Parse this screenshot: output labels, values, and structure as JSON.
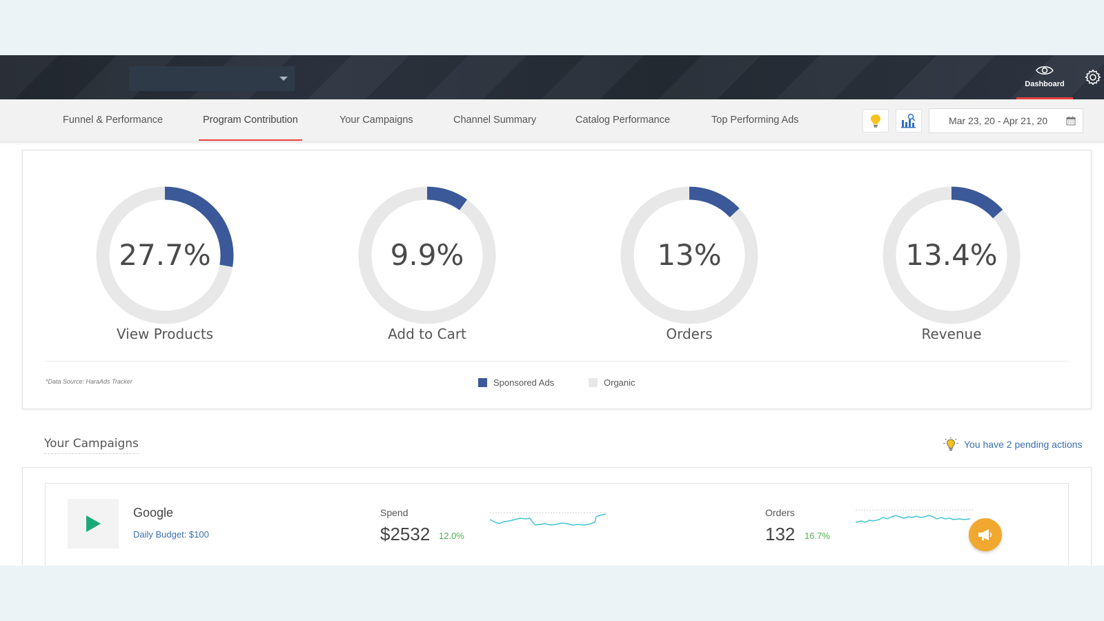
{
  "header": {
    "account_select_value": "",
    "dashboard_label": "Dashboard"
  },
  "nav": {
    "tabs": [
      {
        "label": "Funnel & Performance"
      },
      {
        "label": "Program Contribution",
        "active": true
      },
      {
        "label": "Your Campaigns"
      },
      {
        "label": "Channel Summary"
      },
      {
        "label": "Catalog Performance"
      },
      {
        "label": "Top Performing Ads"
      }
    ],
    "date_range": "Mar 23, 20 - Apr 21, 20"
  },
  "contribution": {
    "metrics": [
      {
        "pct_label": "27.7%",
        "value": 27.7,
        "label": "View Products"
      },
      {
        "pct_label": "9.9%",
        "value": 9.9,
        "label": "Add to Cart"
      },
      {
        "pct_label": "13%",
        "value": 13,
        "label": "Orders"
      },
      {
        "pct_label": "13.4%",
        "value": 13.4,
        "label": "Revenue"
      }
    ],
    "source_note": "*Data Source: HaraAds Tracker",
    "legend": [
      {
        "label": "Sponsored Ads",
        "color": "#3b5998"
      },
      {
        "label": "Organic",
        "color": "#e8e8e8"
      }
    ]
  },
  "colors": {
    "sponsored": "#3b5998",
    "organic": "#e8e8e8",
    "accent": "#e9403c",
    "positive": "#4caf50",
    "link": "#3a6fb0"
  },
  "campaigns": {
    "title": "Your Campaigns",
    "pending_text": "You have 2 pending actions",
    "items": [
      {
        "icon": "play-icon",
        "name": "Google",
        "budget": "Daily Budget: $100",
        "spend": {
          "label": "Spend",
          "value": "$2532",
          "change": "12.0%"
        },
        "orders": {
          "label": "Orders",
          "value": "132",
          "change": "16.7%"
        }
      }
    ]
  }
}
